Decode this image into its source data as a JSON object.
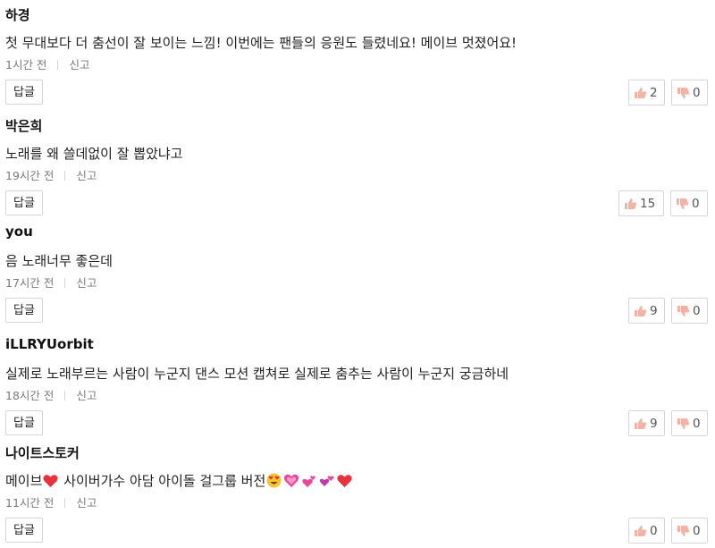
{
  "colors": {
    "thumb_up": "#f2b3a6",
    "thumb_down": "#f2b3a6",
    "heart": "#e8323c",
    "meta_text": "#7a7a7a",
    "border": "#d5d5d5"
  },
  "comments": [
    {
      "author": "하경",
      "text": "첫 무대보다 더 춤선이 잘 보이는 느낌! 이번에는 팬들의 응원도 들렸네요! 메이브 멋졌어요!",
      "time": "1시간 전",
      "report": "신고",
      "reply": "답글",
      "likes": "2",
      "dislikes": "0"
    },
    {
      "author": "박은희",
      "text": "노래를 왜 쓸데없이 잘 뽑았냐고",
      "time": "19시간 전",
      "report": "신고",
      "reply": "답글",
      "likes": "15",
      "dislikes": "0"
    },
    {
      "author": "you",
      "text": "음 노래너무 좋은데",
      "time": "17시간 전",
      "report": "신고",
      "reply": "답글",
      "likes": "9",
      "dislikes": "0"
    },
    {
      "author": "iLLRYUorbit",
      "text": "실제로 노래부르는 사람이 누군지 댄스 모션 캡쳐로 실제로 춤추는 사람이 누군지 궁금하네",
      "time": "18시간 전",
      "report": "신고",
      "reply": "답글",
      "likes": "9",
      "dislikes": "0"
    },
    {
      "author": "나이트스토커",
      "text_part1": "메이브",
      "text_part2": " 사이버가수 아담 아이돌 걸그룹 버전",
      "emoji_icons": [
        "red-heart-icon",
        "heart-eyes-face-icon",
        "sparkling-heart-icon",
        "two-hearts-icon",
        "revolving-hearts-icon",
        "red-heart-icon"
      ],
      "time": "11시간 전",
      "report": "신고",
      "reply": "답글",
      "likes": "0",
      "dislikes": "0"
    }
  ]
}
